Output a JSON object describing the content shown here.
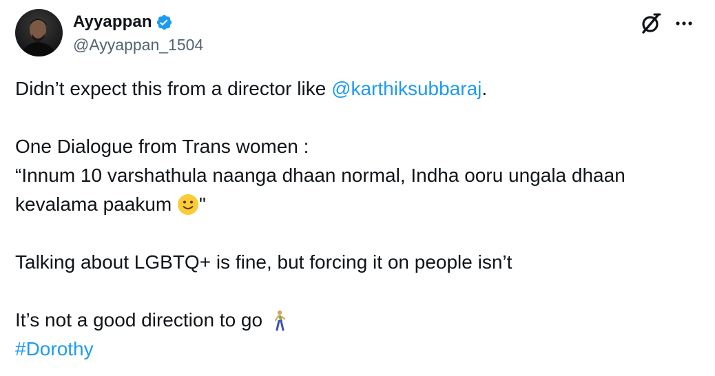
{
  "author": {
    "display_name": "Ayyappan",
    "handle": "@Ayyappan_1504",
    "verified_icon": "verified-badge-icon",
    "verified_color": "#1d9bf0"
  },
  "actions": {
    "grok_icon": "grok-icon",
    "more_icon": "more-horizontal-icon"
  },
  "tweet": {
    "line1_prefix": "Didn’t expect this from a director like ",
    "line1_mention": "@karthiksubbaraj",
    "line1_suffix": ".",
    "line2": "One Dialogue from Trans women :",
    "line3": "“Innum 10 varshathula naanga dhaan normal, Indha ooru ungala dhaan",
    "line4_prefix": "kevalama paakum ",
    "line4_emoji": "slightly-smiling-face-emoji",
    "line4_suffix": "\"",
    "line5": "Talking about LGBTQ+ is fine, but forcing it on people isn’t",
    "line6_prefix": "It’s not a good direction to go ",
    "line6_emoji": "person-walking-emoji",
    "hashtag": "#Dorothy"
  },
  "colors": {
    "text": "#0f1419",
    "secondary": "#536471",
    "link": "#1d9bf0"
  }
}
